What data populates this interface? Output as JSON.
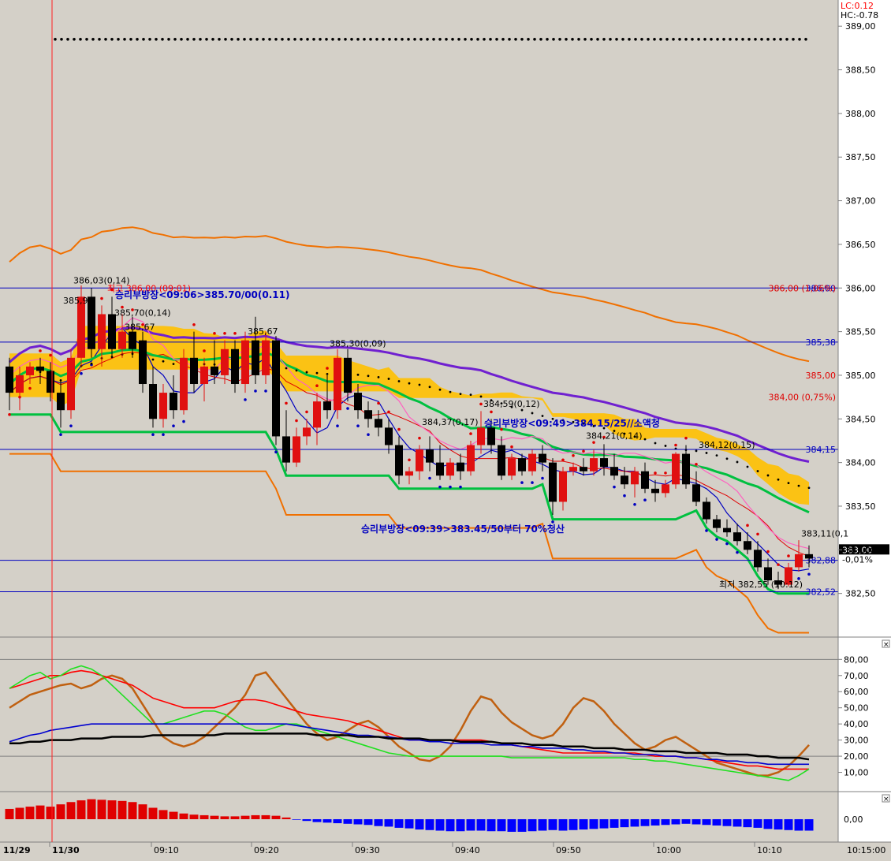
{
  "header": {
    "lc_label": "LC:0.12",
    "hc_label": "HC:-0.78"
  },
  "colors": {
    "background": "#d4d0c8",
    "axis_bg": "#ffffff",
    "up": "#e01010",
    "down": "#000000",
    "cloud": "#ffc000",
    "cloud_light": "#ffe066",
    "cyan": "#40d0e8",
    "purple": "#7020d0",
    "green": "#00c040",
    "orange": "#f07000",
    "blue": "#0000c0",
    "pink": "#ff60c0",
    "red": "#e00000"
  },
  "chart_data": [
    {
      "type": "candlestick",
      "ylim": [
        382.0,
        389.3
      ],
      "y_ticks": [
        "389,00",
        "388,50",
        "388,00",
        "387,50",
        "387,00",
        "386,50",
        "386,00",
        "385,50",
        "385,00",
        "384,50",
        "384,00",
        "383,50",
        "383,00",
        "382,50"
      ],
      "y_tick_values": [
        389.0,
        388.5,
        388.0,
        387.5,
        387.0,
        386.5,
        386.0,
        385.5,
        385.0,
        384.5,
        384.0,
        383.5,
        383.0,
        382.5
      ],
      "x_labels": [
        "11/29",
        "11/30",
        "09:10",
        "09:20",
        "09:30",
        "09:40",
        "09:50",
        "10:00",
        "10:10",
        "10:15:00"
      ],
      "candles": [
        [
          385.1,
          385.2,
          384.6,
          384.8
        ],
        [
          384.8,
          385.1,
          384.6,
          385.0
        ],
        [
          385.0,
          385.15,
          384.9,
          385.1
        ],
        [
          385.1,
          385.2,
          384.9,
          385.05
        ],
        [
          385.05,
          385.15,
          384.7,
          384.8
        ],
        [
          384.8,
          384.95,
          384.4,
          384.6
        ],
        [
          384.6,
          385.3,
          384.5,
          385.2
        ],
        [
          385.2,
          386.03,
          385.1,
          385.9
        ],
        [
          385.9,
          386.0,
          385.2,
          385.3
        ],
        [
          385.3,
          385.8,
          385.1,
          385.7
        ],
        [
          385.7,
          385.9,
          385.2,
          385.3
        ],
        [
          385.3,
          385.7,
          385.2,
          385.5
        ],
        [
          385.5,
          385.67,
          385.2,
          385.3
        ],
        [
          385.4,
          385.5,
          384.8,
          384.9
        ],
        [
          384.9,
          385.1,
          384.4,
          384.5
        ],
        [
          384.5,
          384.9,
          384.4,
          384.8
        ],
        [
          384.8,
          385.0,
          384.5,
          384.6
        ],
        [
          384.6,
          385.3,
          384.55,
          385.2
        ],
        [
          385.2,
          385.5,
          384.8,
          384.9
        ],
        [
          384.9,
          385.2,
          384.7,
          385.1
        ],
        [
          385.1,
          385.4,
          384.9,
          385.0
        ],
        [
          385.0,
          385.4,
          384.9,
          385.3
        ],
        [
          385.3,
          385.4,
          384.8,
          384.9
        ],
        [
          384.9,
          385.5,
          384.8,
          385.4
        ],
        [
          385.4,
          385.67,
          384.9,
          385.0
        ],
        [
          385.0,
          385.5,
          384.9,
          385.4
        ],
        [
          385.4,
          385.45,
          384.2,
          384.3
        ],
        [
          384.3,
          384.6,
          383.9,
          384.0
        ],
        [
          384.0,
          384.4,
          383.95,
          384.3
        ],
        [
          384.3,
          384.5,
          384.2,
          384.4
        ],
        [
          384.4,
          384.8,
          384.2,
          384.7
        ],
        [
          384.7,
          385.0,
          384.5,
          384.6
        ],
        [
          384.6,
          385.3,
          384.5,
          385.2
        ],
        [
          385.2,
          385.3,
          384.7,
          384.8
        ],
        [
          384.8,
          384.9,
          384.5,
          384.6
        ],
        [
          384.6,
          384.7,
          384.4,
          384.5
        ],
        [
          384.5,
          384.6,
          384.3,
          384.4
        ],
        [
          384.4,
          384.5,
          384.1,
          384.2
        ],
        [
          384.2,
          384.3,
          383.75,
          383.85
        ],
        [
          383.85,
          383.95,
          383.75,
          383.9
        ],
        [
          383.9,
          384.2,
          383.8,
          384.15
        ],
        [
          384.15,
          384.3,
          383.9,
          384.0
        ],
        [
          384.0,
          384.2,
          383.8,
          383.85
        ],
        [
          383.85,
          384.05,
          383.8,
          384.0
        ],
        [
          384.0,
          384.1,
          383.8,
          383.9
        ],
        [
          383.9,
          384.25,
          383.85,
          384.2
        ],
        [
          384.2,
          384.59,
          384.1,
          384.4
        ],
        [
          384.4,
          384.5,
          384.1,
          384.2
        ],
        [
          384.2,
          384.3,
          383.8,
          383.85
        ],
        [
          383.85,
          384.1,
          383.8,
          384.05
        ],
        [
          384.05,
          384.1,
          383.85,
          383.9
        ],
        [
          383.9,
          384.15,
          383.85,
          384.1
        ],
        [
          384.1,
          384.2,
          383.9,
          384.0
        ],
        [
          384.0,
          384.05,
          383.4,
          383.55
        ],
        [
          383.55,
          383.95,
          383.45,
          383.9
        ],
        [
          383.9,
          384.0,
          383.85,
          383.95
        ],
        [
          383.95,
          384.05,
          383.85,
          383.9
        ],
        [
          383.9,
          384.15,
          383.85,
          384.05
        ],
        [
          384.05,
          384.21,
          383.85,
          383.95
        ],
        [
          383.95,
          384.1,
          383.8,
          383.85
        ],
        [
          383.85,
          383.95,
          383.7,
          383.75
        ],
        [
          383.75,
          383.95,
          383.6,
          383.9
        ],
        [
          383.9,
          384.0,
          383.65,
          383.7
        ],
        [
          383.7,
          383.8,
          383.55,
          383.65
        ],
        [
          383.65,
          383.8,
          383.6,
          383.75
        ],
        [
          383.75,
          384.12,
          383.7,
          384.1
        ],
        [
          384.1,
          384.2,
          383.7,
          383.75
        ],
        [
          383.75,
          383.9,
          383.5,
          383.55
        ],
        [
          383.55,
          383.6,
          383.3,
          383.35
        ],
        [
          383.35,
          383.4,
          383.2,
          383.25
        ],
        [
          383.25,
          383.35,
          383.15,
          383.2
        ],
        [
          383.2,
          383.3,
          383.05,
          383.1
        ],
        [
          383.1,
          383.2,
          382.95,
          383.0
        ],
        [
          383.0,
          383.1,
          382.75,
          382.8
        ],
        [
          382.8,
          382.9,
          382.6,
          382.65
        ],
        [
          382.65,
          382.75,
          382.55,
          382.6
        ],
        [
          382.6,
          382.85,
          382.58,
          382.8
        ],
        [
          382.8,
          383.11,
          382.75,
          382.95
        ],
        [
          382.95,
          383.05,
          382.8,
          382.9
        ]
      ],
      "reference_lines": [
        {
          "value": 386.0,
          "label": "386,00"
        },
        {
          "value": 385.38,
          "label": "385,38"
        },
        {
          "value": 384.15,
          "label": "384,15"
        },
        {
          "value": 382.88,
          "label": "382,88"
        },
        {
          "value": 382.52,
          "label": "382,52"
        }
      ],
      "right_labels": [
        {
          "value": 386.0,
          "text": "386,00 (1,06%)"
        },
        {
          "value": 385.0,
          "text": "385,00"
        },
        {
          "value": 384.75,
          "text": "384,00 (0,75%)"
        }
      ],
      "current_price": {
        "value": 383.0,
        "label": "383,00",
        "change": "-0,01%"
      },
      "annotations": [
        {
          "text": "386,03(0,14)",
          "x_index": 7,
          "value": 386.05
        },
        {
          "text": "385,99",
          "x_index": 6,
          "value": 385.82
        },
        {
          "text": "385,70(0,14)",
          "x_index": 11,
          "value": 385.68
        },
        {
          "text": "385,67",
          "x_index": 12,
          "value": 385.52
        },
        {
          "text": "385,67",
          "x_index": 24,
          "value": 385.47
        },
        {
          "text": "385,30(0,09)",
          "x_index": 32,
          "value": 385.33
        },
        {
          "text": "384,37(0,17)",
          "x_index": 41,
          "value": 384.43
        },
        {
          "text": "384,59(0,12)",
          "x_index": 47,
          "value": 384.64
        },
        {
          "text": "384,21(0,14)",
          "x_index": 57,
          "value": 384.27
        },
        {
          "text": "384,12(0,15)",
          "x_index": 68,
          "value": 384.17
        },
        {
          "text": "383,11(0,1",
          "x_index": 78,
          "value": 383.15
        },
        {
          "text": "최저 382,55 (10:12)",
          "x_index": 70,
          "value": 382.57
        }
      ],
      "boxed_notes": [
        {
          "text": "승리부방장<09:06>385.70/00(0.11)",
          "x_index": 10,
          "value": 385.92
        },
        {
          "text": "승리부방장<09:49>384.15/25//소액청",
          "x_index": 46,
          "value": 384.45
        },
        {
          "text": "승리부방장<09:39>383.45/50부터 70%청산",
          "x_index": 34,
          "value": 383.24
        }
      ],
      "top_note": "최고 386,00 (09:01)"
    },
    {
      "type": "line",
      "ylim": [
        0,
        87
      ],
      "y_ticks": [
        "80,00",
        "70,00",
        "60,00",
        "50,00",
        "40,00",
        "30,00",
        "20,00",
        "10,00"
      ],
      "y_tick_values": [
        80,
        70,
        60,
        50,
        40,
        30,
        20,
        10
      ],
      "series": [
        {
          "color": "#c06010",
          "values": [
            50,
            54,
            58,
            60,
            62,
            64,
            65,
            62,
            64,
            68,
            70,
            68,
            62,
            52,
            42,
            32,
            28,
            26,
            28,
            32,
            38,
            44,
            50,
            58,
            70,
            72,
            64,
            56,
            48,
            40,
            34,
            30,
            32,
            36,
            40,
            42,
            38,
            32,
            26,
            22,
            18,
            17,
            20,
            26,
            36,
            48,
            57,
            55,
            47,
            41,
            37,
            33,
            31,
            33,
            40,
            50,
            56,
            54,
            48,
            40,
            34,
            28,
            24,
            26,
            30,
            32,
            28,
            24,
            20,
            16,
            14,
            12,
            10,
            8,
            8,
            10,
            14,
            20,
            27
          ]
        },
        {
          "color": "#ff0000",
          "values": [
            62,
            64,
            66,
            68,
            70,
            70,
            72,
            73,
            72,
            70,
            68,
            66,
            64,
            60,
            56,
            54,
            52,
            50,
            50,
            50,
            50,
            52,
            54,
            55,
            55,
            54,
            52,
            50,
            48,
            46,
            45,
            44,
            43,
            42,
            40,
            38,
            36,
            34,
            32,
            30,
            30,
            30,
            30,
            30,
            30,
            30,
            30,
            29,
            28,
            27,
            26,
            25,
            24,
            23,
            22,
            22,
            22,
            22,
            22,
            22,
            22,
            22,
            21,
            20,
            20,
            20,
            19,
            19,
            18,
            17,
            16,
            15,
            14,
            14,
            13,
            12,
            12,
            12,
            12
          ]
        },
        {
          "color": "#20e020",
          "values": [
            62,
            66,
            70,
            72,
            68,
            70,
            74,
            76,
            74,
            70,
            64,
            58,
            52,
            46,
            40,
            40,
            42,
            44,
            46,
            48,
            48,
            46,
            42,
            38,
            36,
            36,
            38,
            40,
            40,
            38,
            36,
            34,
            32,
            30,
            28,
            26,
            24,
            22,
            21,
            20,
            20,
            20,
            20,
            20,
            20,
            20,
            20,
            20,
            20,
            19,
            19,
            19,
            19,
            19,
            19,
            19,
            19,
            19,
            19,
            19,
            19,
            18,
            18,
            17,
            17,
            16,
            15,
            14,
            13,
            12,
            11,
            10,
            9,
            8,
            7,
            6,
            5,
            8,
            12
          ]
        },
        {
          "color": "#0000d0",
          "values": [
            29,
            31,
            33,
            34,
            36,
            37,
            38,
            39,
            40,
            40,
            40,
            40,
            40,
            40,
            40,
            40,
            40,
            40,
            40,
            40,
            40,
            40,
            40,
            40,
            40,
            40,
            40,
            40,
            39,
            38,
            37,
            36,
            35,
            34,
            33,
            33,
            32,
            32,
            31,
            30,
            30,
            29,
            29,
            28,
            28,
            28,
            28,
            27,
            27,
            27,
            26,
            26,
            25,
            25,
            25,
            24,
            24,
            23,
            23,
            22,
            22,
            21,
            21,
            21,
            20,
            20,
            19,
            19,
            18,
            18,
            17,
            17,
            16,
            16,
            15,
            15,
            15,
            15,
            15
          ]
        },
        {
          "color": "#000000",
          "values": [
            28,
            28,
            29,
            29,
            30,
            30,
            30,
            31,
            31,
            31,
            32,
            32,
            32,
            32,
            33,
            33,
            33,
            33,
            33,
            33,
            33,
            34,
            34,
            34,
            34,
            34,
            34,
            34,
            34,
            34,
            33,
            33,
            33,
            33,
            32,
            32,
            32,
            31,
            31,
            31,
            31,
            30,
            30,
            30,
            29,
            29,
            29,
            29,
            28,
            28,
            28,
            27,
            27,
            27,
            26,
            26,
            26,
            25,
            25,
            25,
            24,
            24,
            24,
            23,
            23,
            23,
            22,
            22,
            22,
            22,
            21,
            21,
            21,
            20,
            20,
            19,
            19,
            19,
            18
          ]
        }
      ]
    },
    {
      "type": "bar",
      "ylim": [
        -4,
        4
      ],
      "y_ticks": [
        "0,00"
      ],
      "y_tick_values": [
        0
      ],
      "values": [
        1.8,
        2.0,
        2.2,
        2.4,
        2.2,
        2.6,
        3.0,
        3.3,
        3.5,
        3.4,
        3.3,
        3.2,
        3.0,
        2.6,
        2.0,
        1.6,
        1.3,
        1.0,
        0.8,
        0.7,
        0.6,
        0.5,
        0.5,
        0.6,
        0.7,
        0.7,
        0.6,
        0.3,
        -0.1,
        -0.3,
        -0.5,
        -0.6,
        -0.7,
        -0.8,
        -0.9,
        -1.0,
        -1.2,
        -1.3,
        -1.5,
        -1.6,
        -1.8,
        -1.9,
        -2.0,
        -2.1,
        -2.1,
        -2.0,
        -2.0,
        -2.1,
        -2.1,
        -2.2,
        -2.2,
        -2.1,
        -2.0,
        -1.9,
        -2.0,
        -1.9,
        -1.8,
        -1.7,
        -1.6,
        -1.5,
        -1.4,
        -1.3,
        -1.2,
        -1.1,
        -1.0,
        -0.9,
        -0.8,
        -0.9,
        -1.0,
        -1.1,
        -1.2,
        -1.3,
        -1.4,
        -1.5,
        -1.7,
        -1.8,
        -1.9,
        -2.0,
        -2.0
      ]
    }
  ]
}
